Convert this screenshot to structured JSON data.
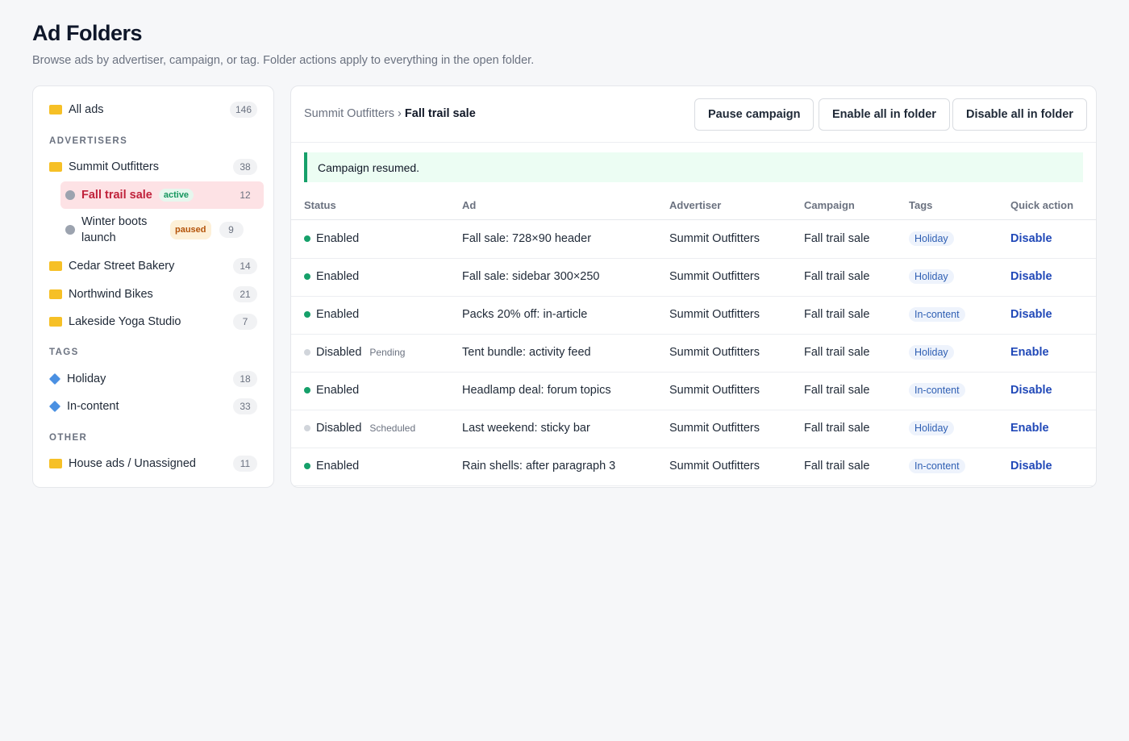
{
  "page": {
    "title": "Ad Folders",
    "subtitle": "Browse ads by advertiser, campaign, or tag. Folder actions apply to everything in the open folder."
  },
  "sidebar": {
    "all_ads": {
      "label": "All ads",
      "count": "146"
    },
    "advertisers_heading": "ADVERTISERS",
    "advertisers": [
      {
        "label": "Summit Outfitters",
        "count": "38"
      },
      {
        "label": "Cedar Street Bakery",
        "count": "14"
      },
      {
        "label": "Northwind Bikes",
        "count": "21"
      },
      {
        "label": "Lakeside Yoga Studio",
        "count": "7"
      }
    ],
    "campaigns": [
      {
        "label": "Fall trail sale",
        "badge": "active",
        "count": "12"
      },
      {
        "label": "Winter boots launch",
        "badge": "paused",
        "count": "9"
      }
    ],
    "tags_heading": "TAGS",
    "tags": [
      {
        "label": "Holiday",
        "count": "18"
      },
      {
        "label": "In-content",
        "count": "33"
      }
    ],
    "other_heading": "OTHER",
    "other": [
      {
        "label": "House ads / Unassigned",
        "count": "11"
      }
    ]
  },
  "toolbar": {
    "breadcrumb_parent": "Summit Outfitters",
    "breadcrumb_sep": "›",
    "breadcrumb_current": "Fall trail sale",
    "pause_label": "Pause campaign",
    "enable_all_label": "Enable all in folder",
    "disable_all_label": "Disable all in folder"
  },
  "notice": "Campaign resumed.",
  "table": {
    "headers": [
      "Status",
      "Ad",
      "Advertiser",
      "Campaign",
      "Tags",
      "Quick action"
    ],
    "rows": [
      {
        "status": "Enabled",
        "note": "",
        "ad": "Fall sale: 728×90 header",
        "advertiser": "Summit Outfitters",
        "campaign": "Fall trail sale",
        "tag": "Holiday",
        "action": "Disable"
      },
      {
        "status": "Enabled",
        "note": "",
        "ad": "Fall sale: sidebar 300×250",
        "advertiser": "Summit Outfitters",
        "campaign": "Fall trail sale",
        "tag": "Holiday",
        "action": "Disable"
      },
      {
        "status": "Enabled",
        "note": "",
        "ad": "Packs 20% off: in-article",
        "advertiser": "Summit Outfitters",
        "campaign": "Fall trail sale",
        "tag": "In-content",
        "action": "Disable"
      },
      {
        "status": "Disabled",
        "note": "Pending",
        "ad": "Tent bundle: activity feed",
        "advertiser": "Summit Outfitters",
        "campaign": "Fall trail sale",
        "tag": "Holiday",
        "action": "Enable"
      },
      {
        "status": "Enabled",
        "note": "",
        "ad": "Headlamp deal: forum topics",
        "advertiser": "Summit Outfitters",
        "campaign": "Fall trail sale",
        "tag": "In-content",
        "action": "Disable"
      },
      {
        "status": "Disabled",
        "note": "Scheduled",
        "ad": "Last weekend: sticky bar",
        "advertiser": "Summit Outfitters",
        "campaign": "Fall trail sale",
        "tag": "Holiday",
        "action": "Enable"
      },
      {
        "status": "Enabled",
        "note": "",
        "ad": "Rain shells: after paragraph 3",
        "advertiser": "Summit Outfitters",
        "campaign": "Fall trail sale",
        "tag": "In-content",
        "action": "Disable"
      }
    ]
  }
}
